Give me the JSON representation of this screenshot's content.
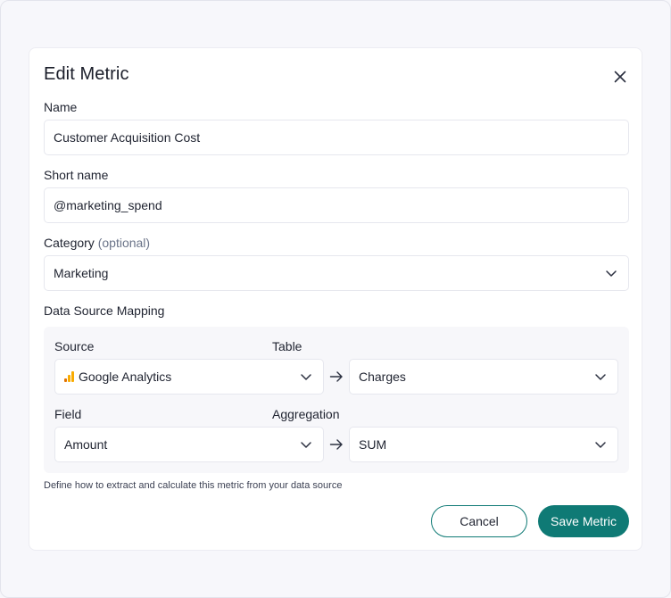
{
  "dialog": {
    "title": "Edit Metric",
    "close_icon": "close-icon"
  },
  "name": {
    "label": "Name",
    "value": "Customer Acquisition Cost"
  },
  "short_name": {
    "label": "Short name",
    "value": "@marketing_spend"
  },
  "category": {
    "label": "Category",
    "optional": "(optional)",
    "value": "Marketing"
  },
  "mapping": {
    "title": "Data Source Mapping",
    "source_label": "Source",
    "source_value": "Google Analytics",
    "source_icon": "google-analytics-icon",
    "table_label": "Table",
    "table_value": "Charges",
    "field_label": "Field",
    "field_value": "Amount",
    "aggregation_label": "Aggregation",
    "aggregation_value": "SUM",
    "help": "Define how to extract and calculate this metric from your data source"
  },
  "actions": {
    "cancel": "Cancel",
    "save": "Save Metric"
  },
  "colors": {
    "accent": "#0f7a75",
    "analytics_orange": "#f9ab00",
    "analytics_dark": "#e37400"
  }
}
